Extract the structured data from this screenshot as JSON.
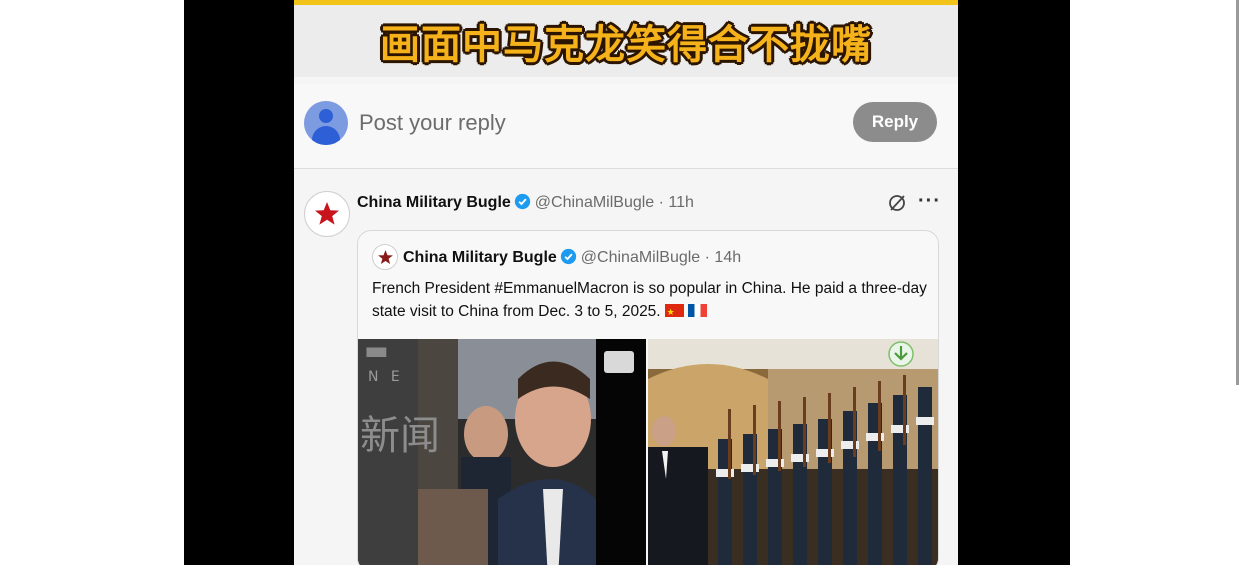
{
  "banner": {
    "text": "画面中马克龙笑得合不拢嘴"
  },
  "reply": {
    "placeholder": "Post your reply",
    "button_label": "Reply"
  },
  "tweet": {
    "name": "China Military Bugle",
    "handle": "@ChinaMilBugle",
    "time": "· 11h",
    "more": "···"
  },
  "quote": {
    "name": "China Military Bugle",
    "handle": "@ChinaMilBugle",
    "time": "· 14h",
    "text": "French President #EmmanuelMacron is so popular in China. He paid a three-day state visit to China from Dec. 3 to 5, 2025."
  },
  "media_watermark": {
    "line1": "N E",
    "line2": "新闻"
  },
  "colors": {
    "banner_text": "#f6b21a",
    "reply_button": "#8c8c8c",
    "verified": "#1d9bf0",
    "side_bars": "#000000"
  },
  "icons": [
    "user-avatar-icon",
    "red-star-icon",
    "verified-badge-icon",
    "grok-icon",
    "more-icon",
    "flag-cn-icon",
    "flag-fr-icon",
    "download-icon",
    "media-frame-icon"
  ]
}
